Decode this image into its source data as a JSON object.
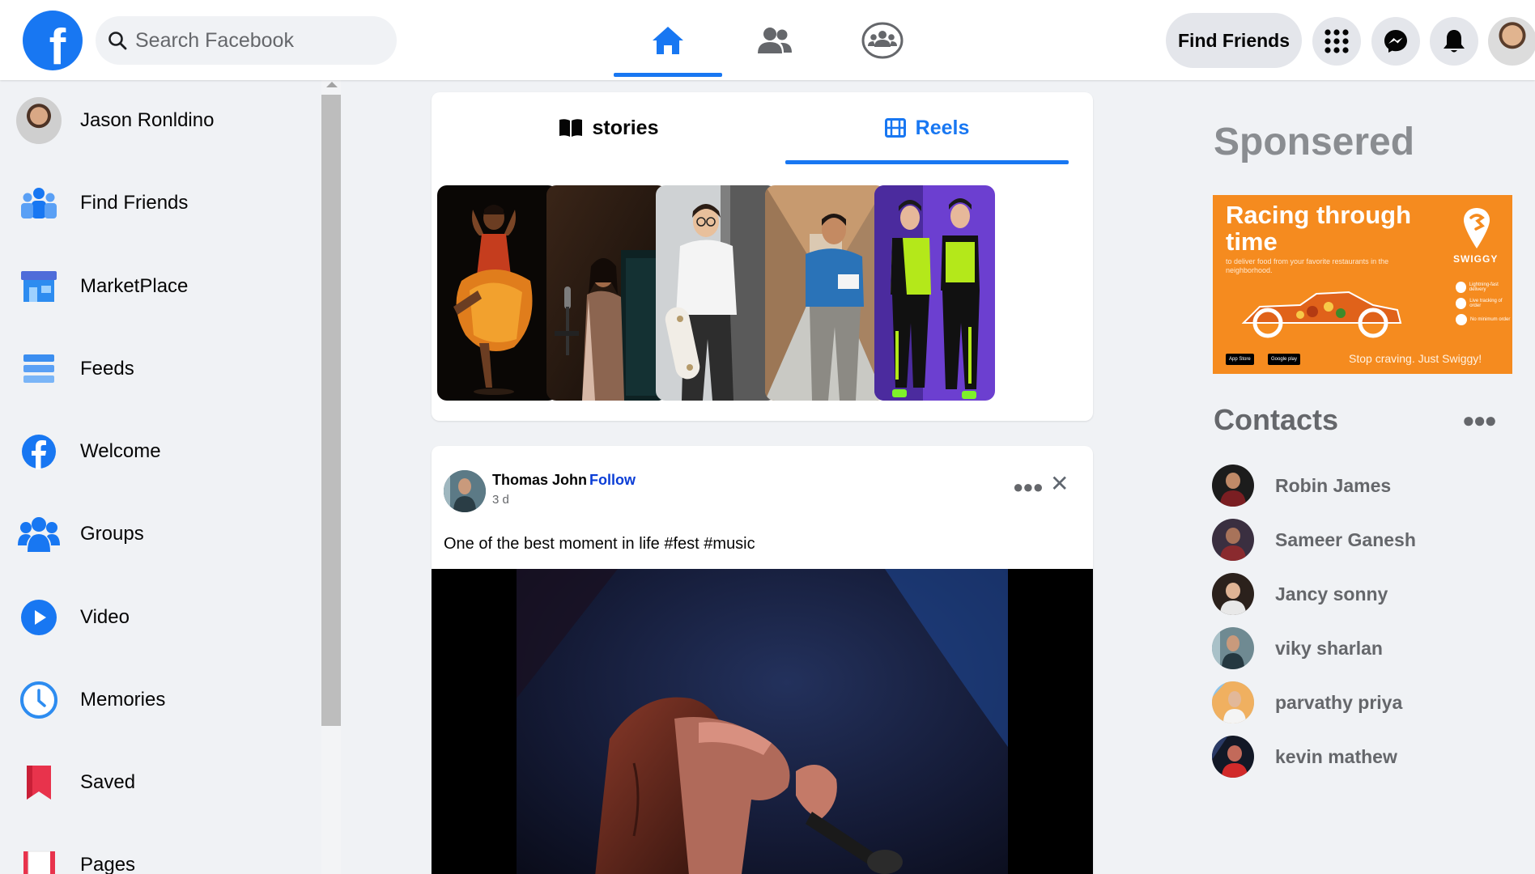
{
  "header": {
    "logo_letter": "f",
    "search_placeholder": "Search Facebook",
    "nav_tabs": [
      "home-icon",
      "friends-icon",
      "groups-icon"
    ],
    "find_friends_label": "Find Friends",
    "right_icons": [
      "menu-grid-icon",
      "messenger-icon",
      "bell-icon"
    ]
  },
  "sidebar": {
    "profile_name": "Jason Ronldino",
    "items": [
      {
        "label": "Find Friends",
        "icon": "friends-icon"
      },
      {
        "label": "MarketPlace",
        "icon": "marketplace-icon"
      },
      {
        "label": "Feeds",
        "icon": "feeds-icon"
      },
      {
        "label": "Welcome",
        "icon": "facebook-icon"
      },
      {
        "label": "Groups",
        "icon": "groups-icon"
      },
      {
        "label": "Video",
        "icon": "video-icon"
      },
      {
        "label": "Memories",
        "icon": "clock-icon"
      },
      {
        "label": "Saved",
        "icon": "bookmark-icon"
      },
      {
        "label": "Pages",
        "icon": "flag-icon"
      }
    ]
  },
  "stories": {
    "tab_stories": "stories",
    "tab_reels": "Reels",
    "active_tab": "Reels"
  },
  "post": {
    "author": "Thomas John",
    "follow_label": "Follow",
    "time": "3 d",
    "text": "One of the best moment in life #fest #music"
  },
  "right": {
    "sponsored_title": "Sponsered",
    "ad": {
      "headline": "Racing through time",
      "subtext": "to deliver food from your favorite restaurants in the neighborhood.",
      "brand": "SWIGGY",
      "tagline": "Stop craving. Just Swiggy!",
      "store_badges": [
        "App Store",
        "Google play"
      ],
      "features": [
        "Lightning-fast delivery",
        "Live tracking of order",
        "No minimum order"
      ],
      "accent_color": "#f58b1f"
    },
    "contacts_title": "Contacts",
    "contacts": [
      "Robin James",
      "Sameer Ganesh",
      "Jancy sonny",
      "viky sharlan",
      "parvathy priya",
      "kevin mathew"
    ]
  },
  "colors": {
    "brand_blue": "#1877f2",
    "background": "#f0f2f5",
    "follow_link": "#0a3dd6"
  }
}
